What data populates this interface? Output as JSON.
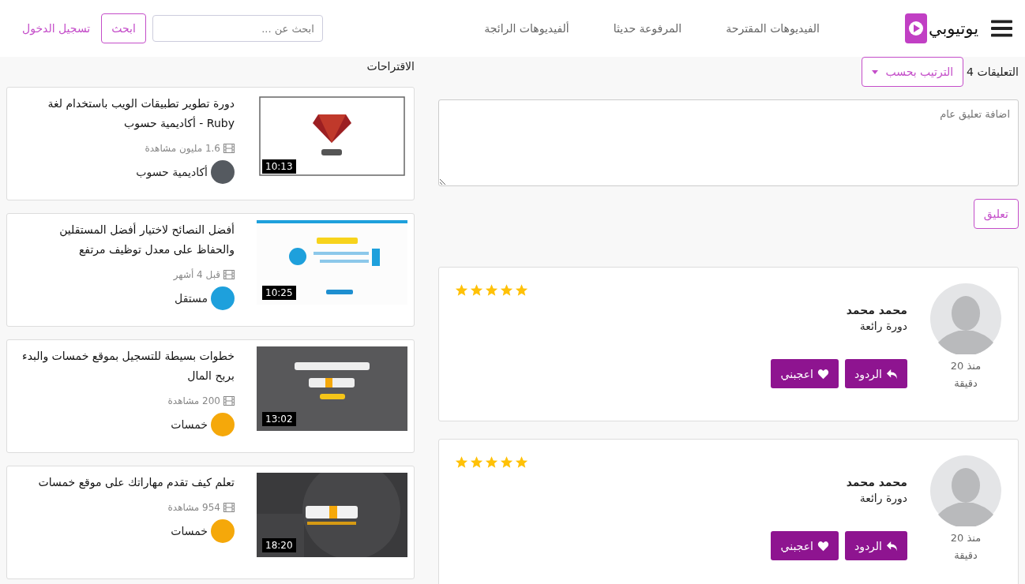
{
  "header": {
    "brand": "يوتيوبي",
    "nav": [
      {
        "label": "الفيديوهات المقترحة"
      },
      {
        "label": "المرفوعة حديثا"
      },
      {
        "label": "ألفيديوهات الرائجة"
      }
    ],
    "search": {
      "placeholder": "ابحث عن ..."
    },
    "search_button": "ابحث",
    "login": "تسجيل الدخول"
  },
  "comments": {
    "title": "التعليقات 4",
    "sort": "الترتيب بحسب",
    "input": {
      "placeholder": "اضافة تعليق عام"
    },
    "submit": "تعليق",
    "items": [
      {
        "time": "منذ 20 دقيقة",
        "author": "محمد محمد",
        "text": "دورة رائعة",
        "stars": 5,
        "replies": "الردود",
        "like": "اعجبني"
      },
      {
        "time": "منذ 20 دقيقة",
        "author": "محمد محمد",
        "text": "دورة رائعة",
        "stars": 5,
        "replies": "الردود",
        "like": "اعجبني"
      }
    ]
  },
  "suggestions": {
    "title": "الاقتراحات",
    "items": [
      {
        "title": "دورة تطوير تطبيقات الويب باستخدام لغة Ruby - أكاديمية حسوب",
        "duration": "10:13",
        "meta": "1.6 مليون مشاهدة",
        "channel": "أكاديمية حسوب",
        "color": "#555a60"
      },
      {
        "title": "أفضل النصائح لاختيار أفضل المستقلين والحفاظ على معدل توظيف مرتفع",
        "duration": "10:25",
        "meta": "قبل 4 أشهر",
        "channel": "مستقل",
        "color": "#1ea0dc"
      },
      {
        "title": "خطوات بسيطة للتسجيل بموقع خمسات والبدء بربح المال",
        "duration": "13:02",
        "meta": "200 مشاهدة",
        "channel": "خمسات",
        "color": "#f5a80a"
      },
      {
        "title": "تعلم كيف تقدم مهاراتك على موقع خمسات",
        "duration": "18:20",
        "meta": "954 مشاهدة",
        "channel": "خمسات",
        "color": "#f5a80a"
      }
    ]
  }
}
